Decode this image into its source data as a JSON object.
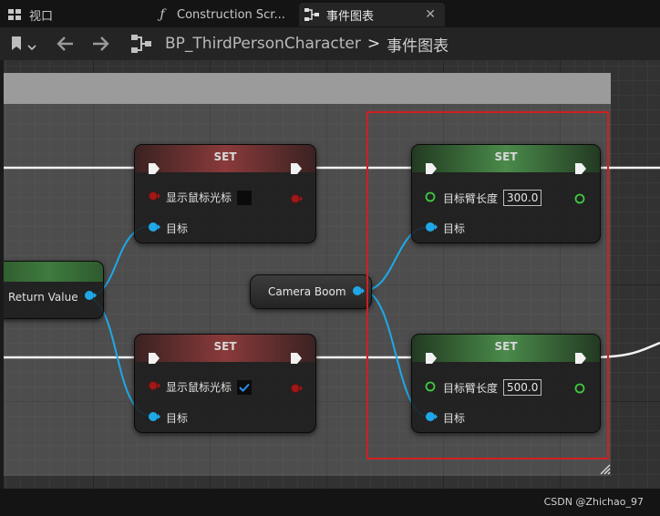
{
  "tabs": [
    {
      "label": "视口",
      "icon": "viewport-grid-icon"
    },
    {
      "label": "Construction Scr...",
      "icon": "function-icon"
    },
    {
      "label": "事件图表",
      "icon": "event-graph-icon",
      "active": true
    }
  ],
  "toolbar": {
    "breadcrumb": {
      "blueprint": "BP_ThirdPersonCharacter",
      "separator": ">",
      "graph": "事件图表"
    }
  },
  "nodes": {
    "set_top_left": {
      "title": "SET",
      "prop": "显示鼠标光标",
      "checked": false,
      "target": "目标"
    },
    "set_bottom_left": {
      "title": "SET",
      "prop": "显示鼠标光标",
      "checked": true,
      "target": "目标"
    },
    "set_top_right": {
      "title": "SET",
      "prop": "目标臂长度",
      "value": "300.0",
      "target": "目标"
    },
    "set_bottom_right": {
      "title": "SET",
      "prop": "目标臂长度",
      "value": "500.0",
      "target": "目标"
    },
    "return_value": {
      "label": "Return Value"
    },
    "camera_boom": {
      "label": "Camera Boom"
    }
  },
  "colors": {
    "exec_wire": "#ffffff",
    "object_pin": "#1fa8e8",
    "bool_pin": "#a01818",
    "float_pin": "#3fc93f",
    "highlight": "#d21f1f"
  },
  "watermark": "CSDN @Zhichao_97"
}
